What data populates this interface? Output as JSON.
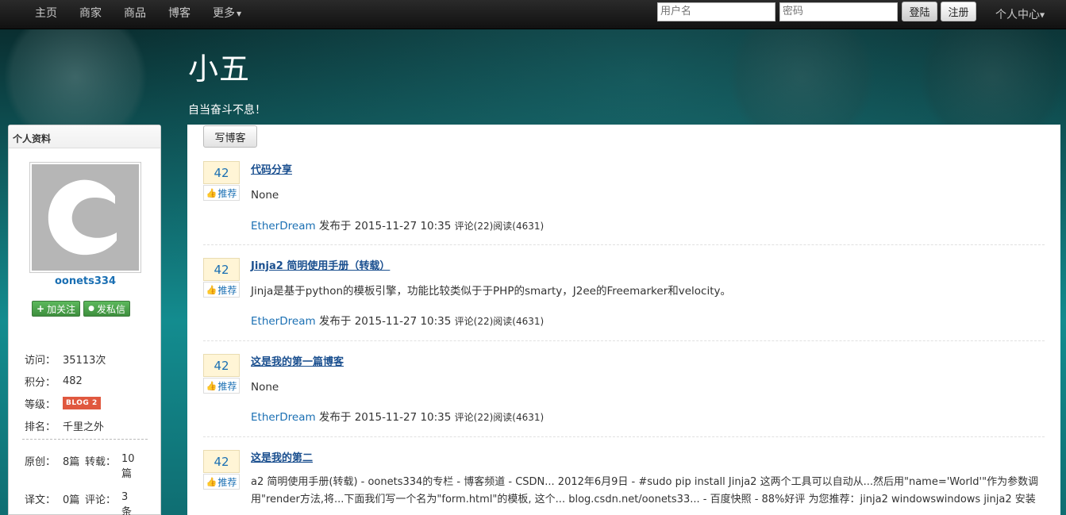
{
  "nav": {
    "items": [
      "主页",
      "商家",
      "商品",
      "博客",
      "更多"
    ],
    "username_placeholder": "用户名",
    "password_placeholder": "密码",
    "login_label": "登陆",
    "register_label": "注册",
    "user_center": "个人中心"
  },
  "blog": {
    "title": "小五",
    "subtitle": "自当奋斗不息！"
  },
  "sidebar": {
    "header": "个人资料",
    "avatar_letter": "C",
    "username": "oonets334",
    "follow_label": "加关注",
    "message_label": "发私信",
    "stats": [
      {
        "label": "访问：",
        "value": "35113次"
      },
      {
        "label": "积分：",
        "value": "482"
      },
      {
        "label": "等级：",
        "value": "BLOG 2"
      },
      {
        "label": "排名：",
        "value": "千里之外"
      }
    ],
    "original_label": "原创：",
    "original_value": "8篇",
    "repost_label": "转载：",
    "repost_value": "10篇",
    "translate_label": "译文：",
    "translate_value": "0篇",
    "comment_label": "评论：",
    "comment_value": "3条"
  },
  "main": {
    "write_label": "写博客",
    "posts": [
      {
        "votes": "42",
        "recommend": "推荐",
        "title": "代码分享",
        "summary": "None",
        "author": "EtherDream",
        "published": " 发布于 2015-11-27 10:35 ",
        "counts": "评论(22)阅读(4631)"
      },
      {
        "votes": "42",
        "recommend": "推荐",
        "title": "Jinja2 简明使用手册（转载）",
        "summary": "Jinja是基于python的模板引擎，功能比较类似于于PHP的smarty，J2ee的Freemarker和velocity。",
        "author": "EtherDream",
        "published": " 发布于 2015-11-27 10:35 ",
        "counts": "评论(22)阅读(4631)"
      },
      {
        "votes": "42",
        "recommend": "推荐",
        "title": "这是我的第一篇博客",
        "summary": "None",
        "author": "EtherDream",
        "published": " 发布于 2015-11-27 10:35 ",
        "counts": "评论(22)阅读(4631)"
      },
      {
        "votes": "42",
        "recommend": "推荐",
        "title": "这是我的第二",
        "summary": "a2 简明使用手册(转载) - oonets334的专栏 - 博客频道 - CSDN... 2012年6月9日 - #sudo pip install Jinja2 这两个工具可以自动从...然后用\"name='World'\"作为参数调用\"render方法,将...下面我们写一个名为\"form.html\"的模板, 这个... blog.csdn.net/oonets33... - 百度快照 - 88%好评 为您推荐：jinja2 windowswindows jinja2 安装"
      }
    ]
  }
}
